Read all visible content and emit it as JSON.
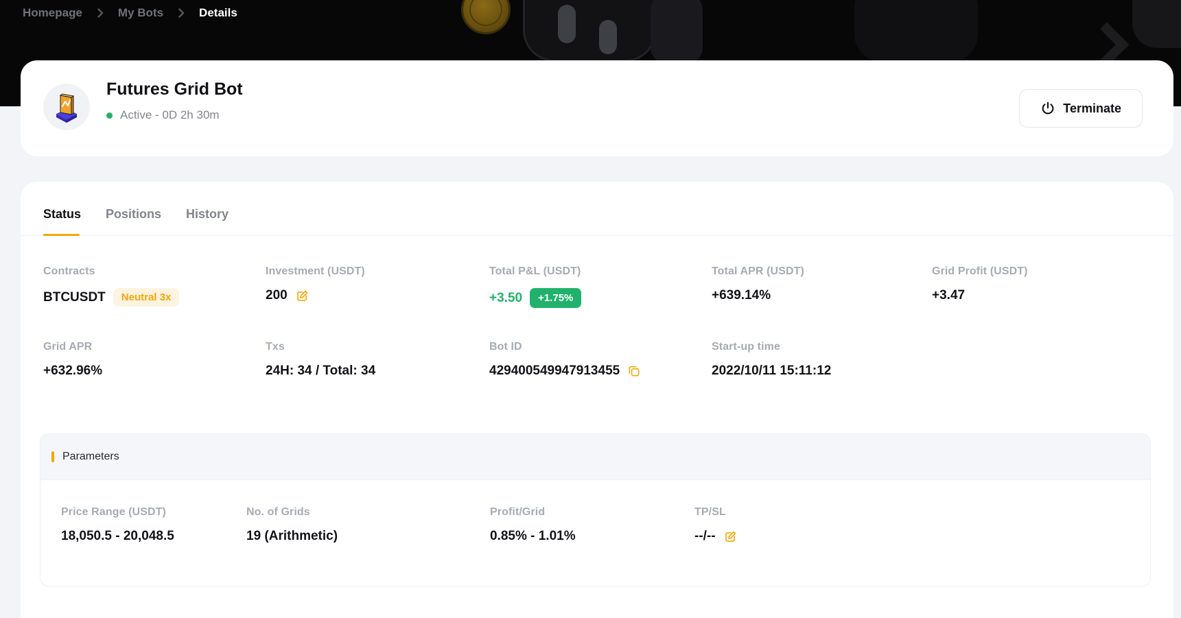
{
  "breadcrumb": {
    "items": [
      {
        "label": "Homepage"
      },
      {
        "label": "My Bots"
      },
      {
        "label": "Details"
      }
    ]
  },
  "header": {
    "title": "Futures Grid Bot",
    "status": "Active - 0D 2h 30m",
    "terminate_label": "Terminate"
  },
  "tabs": [
    {
      "label": "Status"
    },
    {
      "label": "Positions"
    },
    {
      "label": "History"
    }
  ],
  "stats": {
    "row1": [
      {
        "label": "Contracts",
        "value": "BTCUSDT",
        "badge": "Neutral 3x"
      },
      {
        "label": "Investment (USDT)",
        "value": "200"
      },
      {
        "label": "Total P&L (USDT)",
        "value": "+3.50",
        "badge": "+1.75%"
      },
      {
        "label": "Total APR (USDT)",
        "value": "+639.14%"
      },
      {
        "label": "Grid Profit (USDT)",
        "value": "+3.47"
      }
    ],
    "row2": [
      {
        "label": "Grid APR",
        "value": "+632.96%"
      },
      {
        "label": "Txs",
        "value": "24H: 34 / Total: 34"
      },
      {
        "label": "Bot ID",
        "value": "429400549947913455"
      },
      {
        "label": "Start-up time",
        "value": "2022/10/11 15:11:12"
      }
    ]
  },
  "parameters": {
    "title": "Parameters",
    "items": [
      {
        "label": "Price Range (USDT)",
        "value": "18,050.5 - 20,048.5"
      },
      {
        "label": "No. of Grids",
        "value": "19 (Arithmetic)"
      },
      {
        "label": "Profit/Grid",
        "value": "0.85% - 1.01%"
      },
      {
        "label": "TP/SL",
        "value": "--/--"
      }
    ]
  },
  "colors": {
    "accent": "#f7a600",
    "green": "#20b26c",
    "label": "#a6abb3",
    "muted": "#81858c",
    "banner-bg": "#070708"
  }
}
